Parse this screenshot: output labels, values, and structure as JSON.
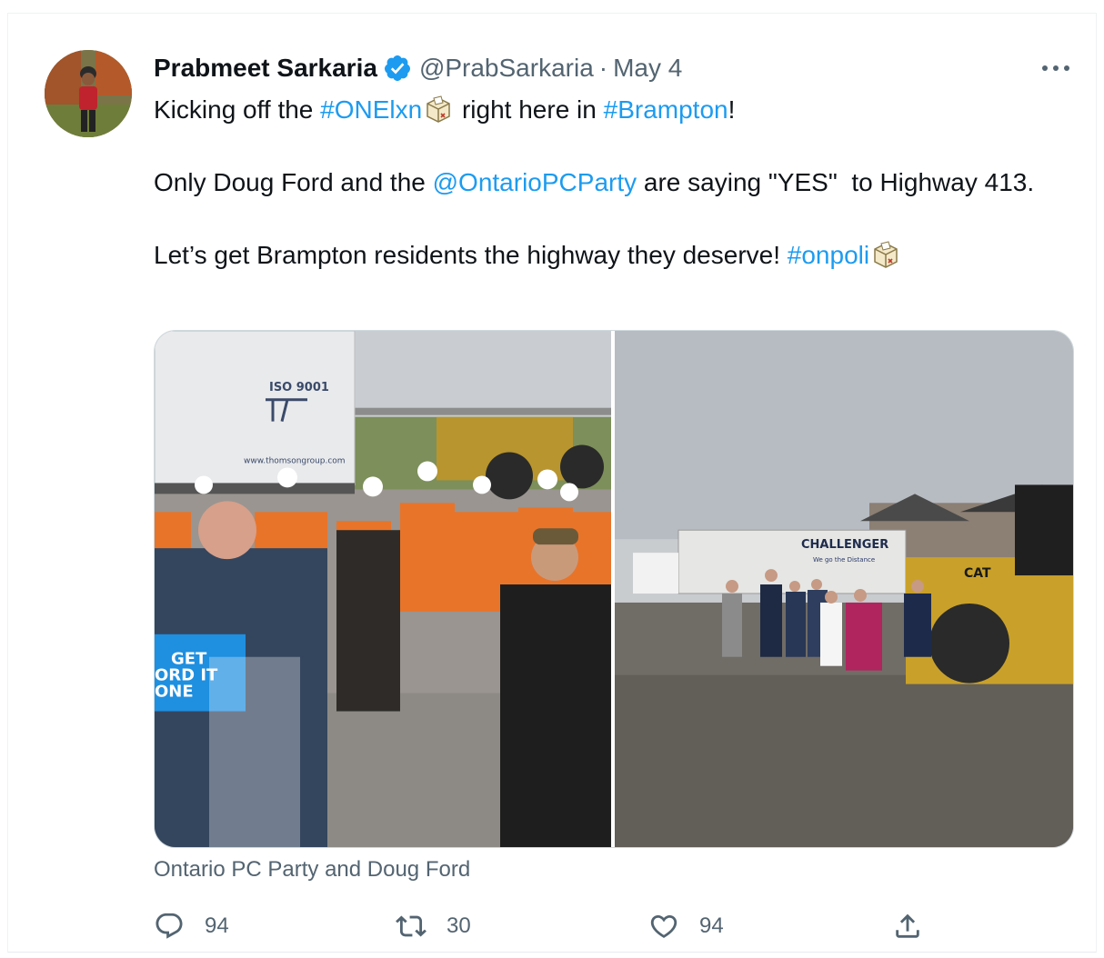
{
  "tweet": {
    "author_name": "Prabmeet Sarkaria",
    "handle": "@PrabSarkaria",
    "separator": "·",
    "date": "May 4",
    "line1": {
      "t1": "Kicking off the ",
      "tag1": "#ONElxn",
      "t2": " right here in ",
      "tag2": "#Brampton",
      "t3": "!"
    },
    "line2": {
      "t1": "Only Doug Ford and the ",
      "mention": "@OntarioPCParty",
      "t2": " are saying \"YES\"  to Highway 413."
    },
    "line3": {
      "t1": "Let’s get Brampton residents the highway they deserve! ",
      "tag": "#onpoli"
    },
    "media_caption": "Ontario PC Party and Doug Ford"
  },
  "photos": {
    "left": {
      "trailer_cert": "ISO 9001",
      "trailer_url": "www.thomsongroup.com",
      "podium_text": [
        "GET",
        "ORD IT",
        "ONE"
      ]
    },
    "right": {
      "trailer_brand": "CHALLENGER",
      "trailer_tagline": "We go the Distance",
      "machine_brand": "CAT"
    }
  },
  "stats": {
    "replies": "94",
    "retweets": "30",
    "likes": "94"
  },
  "icons": {
    "verified": "verified-badge-icon",
    "more": "more-dots-icon",
    "reply": "reply-icon",
    "retweet": "retweet-icon",
    "like": "heart-icon",
    "share": "share-icon",
    "ballot": "ballot-box-icon"
  },
  "colors": {
    "link": "#1d9bf0",
    "secondary_text": "#536471",
    "verified": "#1d9bf0",
    "border": "#cfd9de"
  }
}
